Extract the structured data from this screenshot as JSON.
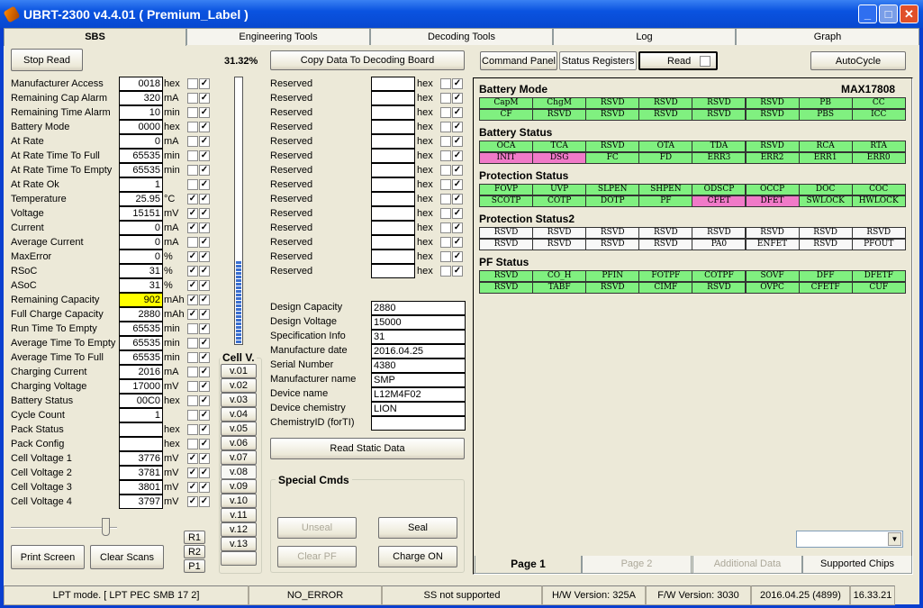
{
  "window": {
    "title": "UBRT-2300 v4.4.01  ( Premium_Label )",
    "minimize": "_",
    "maximize": "□",
    "close": "✕"
  },
  "tabs": [
    {
      "label": "SBS",
      "active": true
    },
    {
      "label": "Engineering Tools"
    },
    {
      "label": "Decoding Tools"
    },
    {
      "label": "Log"
    },
    {
      "label": "Graph"
    }
  ],
  "sbs": {
    "stop_read": "Stop Read",
    "progress_label": "31.32%",
    "progress": 31.32,
    "copy_data": "Copy Data To Decoding Board",
    "rows": [
      {
        "label": "Manufacturer Access",
        "value": "0018",
        "unit": "hex",
        "c1": false,
        "c2": true
      },
      {
        "label": "Remaining Cap Alarm",
        "value": "320",
        "unit": "mA",
        "c1": false,
        "c2": true
      },
      {
        "label": "Remaining Time Alarm",
        "value": "10",
        "unit": "min",
        "c1": false,
        "c2": true
      },
      {
        "label": "Battery Mode",
        "value": "0000",
        "unit": "hex",
        "c1": false,
        "c2": true
      },
      {
        "label": "At Rate",
        "value": "0",
        "unit": "mA",
        "c1": false,
        "c2": true
      },
      {
        "label": "At Rate Time To Full",
        "value": "65535",
        "unit": "min",
        "c1": false,
        "c2": true
      },
      {
        "label": "At Rate Time To Empty",
        "value": "65535",
        "unit": "min",
        "c1": false,
        "c2": true
      },
      {
        "label": "At Rate Ok",
        "value": "1",
        "unit": "",
        "c1": false,
        "c2": true
      },
      {
        "label": "Temperature",
        "value": "25.95",
        "unit": "°C",
        "c1": true,
        "c2": true
      },
      {
        "label": "Voltage",
        "value": "15151",
        "unit": "mV",
        "c1": true,
        "c2": true
      },
      {
        "label": "Current",
        "value": "0",
        "unit": "mA",
        "c1": true,
        "c2": true
      },
      {
        "label": "Average Current",
        "value": "0",
        "unit": "mA",
        "c1": false,
        "c2": true
      },
      {
        "label": "MaxError",
        "value": "0",
        "unit": "%",
        "c1": true,
        "c2": true
      },
      {
        "label": "RSoC",
        "value": "31",
        "unit": "%",
        "c1": true,
        "c2": true
      },
      {
        "label": "ASoC",
        "value": "31",
        "unit": "%",
        "c1": true,
        "c2": true
      },
      {
        "label": "Remaining Capacity",
        "value": "902",
        "unit": "mAh",
        "c1": true,
        "c2": true,
        "highlight": "#ffff00"
      },
      {
        "label": "Full Charge Capacity",
        "value": "2880",
        "unit": "mAh",
        "c1": true,
        "c2": true
      },
      {
        "label": "Run Time To Empty",
        "value": "65535",
        "unit": "min",
        "c1": false,
        "c2": true
      },
      {
        "label": "Average Time To Empty",
        "value": "65535",
        "unit": "min",
        "c1": false,
        "c2": true
      },
      {
        "label": "Average Time To Full",
        "value": "65535",
        "unit": "min",
        "c1": false,
        "c2": true
      },
      {
        "label": "Charging Current",
        "value": "2016",
        "unit": "mA",
        "c1": false,
        "c2": true
      },
      {
        "label": "Charging Voltage",
        "value": "17000",
        "unit": "mV",
        "c1": false,
        "c2": true
      },
      {
        "label": "Battery Status",
        "value": "00C0",
        "unit": "hex",
        "c1": false,
        "c2": true
      },
      {
        "label": "Cycle Count",
        "value": "1",
        "unit": "",
        "c1": false,
        "c2": true
      },
      {
        "label": "Pack Status",
        "value": "",
        "unit": "hex",
        "c1": false,
        "c2": true
      },
      {
        "label": "Pack Config",
        "value": "",
        "unit": "hex",
        "c1": false,
        "c2": true
      },
      {
        "label": "Cell Voltage 1",
        "value": "3776",
        "unit": "mV",
        "c1": true,
        "c2": true
      },
      {
        "label": "Cell Voltage 2",
        "value": "3781",
        "unit": "mV",
        "c1": true,
        "c2": true
      },
      {
        "label": "Cell Voltage 3",
        "value": "3801",
        "unit": "mV",
        "c1": true,
        "c2": true
      },
      {
        "label": "Cell Voltage 4",
        "value": "3797",
        "unit": "mV",
        "c1": true,
        "c2": true
      }
    ],
    "reserved": [
      {
        "label": "Reserved",
        "value": "",
        "unit": "hex",
        "c1": false,
        "c2": true
      },
      {
        "label": "Reserved",
        "value": "",
        "unit": "hex",
        "c1": false,
        "c2": true
      },
      {
        "label": "Reserved",
        "value": "",
        "unit": "hex",
        "c1": false,
        "c2": true
      },
      {
        "label": "Reserved",
        "value": "",
        "unit": "hex",
        "c1": false,
        "c2": true
      },
      {
        "label": "Reserved",
        "value": "",
        "unit": "hex",
        "c1": false,
        "c2": true
      },
      {
        "label": "Reserved",
        "value": "",
        "unit": "hex",
        "c1": false,
        "c2": true
      },
      {
        "label": "Reserved",
        "value": "",
        "unit": "hex",
        "c1": false,
        "c2": true
      },
      {
        "label": "Reserved",
        "value": "",
        "unit": "hex",
        "c1": false,
        "c2": true
      },
      {
        "label": "Reserved",
        "value": "",
        "unit": "hex",
        "c1": false,
        "c2": true
      },
      {
        "label": "Reserved",
        "value": "",
        "unit": "hex",
        "c1": false,
        "c2": true
      },
      {
        "label": "Reserved",
        "value": "",
        "unit": "hex",
        "c1": false,
        "c2": true
      },
      {
        "label": "Reserved",
        "value": "",
        "unit": "hex",
        "c1": false,
        "c2": true
      },
      {
        "label": "Reserved",
        "value": "",
        "unit": "hex",
        "c1": false,
        "c2": true
      },
      {
        "label": "Reserved",
        "value": "",
        "unit": "hex",
        "c1": false,
        "c2": true
      }
    ],
    "static": [
      {
        "label": "Design Capacity",
        "value": "2880"
      },
      {
        "label": "Design Voltage",
        "value": "15000"
      },
      {
        "label": "Specification Info",
        "value": "31"
      },
      {
        "label": "Manufacture date",
        "value": "2016.04.25"
      },
      {
        "label": "Serial Number",
        "value": "4380"
      },
      {
        "label": "Manufacturer name",
        "value": "SMP"
      },
      {
        "label": "Device name",
        "value": "L12M4F02"
      },
      {
        "label": "Device chemistry",
        "value": "LION"
      },
      {
        "label": "ChemistryID (forTI)",
        "value": ""
      }
    ],
    "read_static": "Read Static Data",
    "special_cmds": {
      "title": "Special Cmds",
      "unseal": "Unseal",
      "seal": "Seal",
      "clear_pf": "Clear PF",
      "charge_on": "Charge ON"
    },
    "cell_v": {
      "title": "Cell V.",
      "buttons": [
        "v.01",
        "v.02",
        "v.03",
        "v.04",
        "v.05",
        "v.06",
        "v.07",
        "v.08",
        "v.09",
        "v.10",
        "v.11",
        "v.12",
        "v.13",
        ""
      ],
      "pressed": "v.08"
    },
    "r_buttons": [
      "R1",
      "R2",
      "P1"
    ],
    "print_screen": "Print Screen",
    "clear_scans": "Clear Scans"
  },
  "right": {
    "command_panel": "Command Panel",
    "status_registers": "Status Registers",
    "read": "Read",
    "read_checked": false,
    "autocycle": "AutoCycle",
    "chip": "MAX17808",
    "colors": {
      "green": "#80f080",
      "pink": "#f07ac8",
      "white": "#f8f8f8"
    },
    "sections": [
      {
        "title": "Battery Mode",
        "rows": [
          [
            "CapM",
            "ChgM",
            "RSVD",
            "RSVD",
            "RSVD",
            "RSVD",
            "PB",
            "CC"
          ],
          [
            "CF",
            "RSVD",
            "RSVD",
            "RSVD",
            "RSVD",
            "RSVD",
            "PBS",
            "ICC"
          ]
        ],
        "pink": [],
        "color": "green"
      },
      {
        "title": "Battery Status",
        "rows": [
          [
            "OCA",
            "TCA",
            "RSVD",
            "OTA",
            "TDA",
            "RSVD",
            "RCA",
            "RTA"
          ],
          [
            "INIT",
            "DSG",
            "FC",
            "FD",
            "ERR3",
            "ERR2",
            "ERR1",
            "ERR0"
          ]
        ],
        "pink": [
          "INIT",
          "DSG"
        ],
        "color": "green"
      },
      {
        "title": "Protection Status",
        "rows": [
          [
            "FOVP",
            "UVP",
            "SLPEN",
            "SHPEN",
            "ODSCP",
            "OCCP",
            "DOC",
            "COC"
          ],
          [
            "SCOTP",
            "COTP",
            "DOTP",
            "PF",
            "CFET",
            "DFET",
            "SWLOCK",
            "HWLOCK"
          ]
        ],
        "pink": [
          "CFET",
          "DFET"
        ],
        "color": "green"
      },
      {
        "title": "Protection Status2",
        "rows": [
          [
            "RSVD",
            "RSVD",
            "RSVD",
            "RSVD",
            "RSVD",
            "RSVD",
            "RSVD",
            "RSVD"
          ],
          [
            "RSVD",
            "RSVD",
            "RSVD",
            "RSVD",
            "PA0",
            "ENFET",
            "RSVD",
            "PFOUT"
          ]
        ],
        "pink": [],
        "color": "white"
      },
      {
        "title": "PF Status",
        "rows": [
          [
            "RSVD",
            "CO_H",
            "PFIN",
            "FOTPF",
            "COTPF",
            "SOVF",
            "DFF",
            "DFETF"
          ],
          [
            "RSVD",
            "TABF",
            "RSVD",
            "CIMF",
            "RSVD",
            "OVPC",
            "CFETF",
            "CUF"
          ]
        ],
        "pink": [],
        "color": "green"
      }
    ],
    "dropdown": "",
    "page_tabs": [
      {
        "label": "Page 1",
        "active": true
      },
      {
        "label": "Page 2",
        "disabled": true
      },
      {
        "label": "Additional Data",
        "disabled": true
      },
      {
        "label": "Supported Chips"
      }
    ]
  },
  "statusbar": [
    "LPT mode. [ LPT  PEC  SMB  17 2]",
    "NO_ERROR",
    "SS not supported",
    "H/W Version: 325A",
    "F/W Version: 3030",
    "2016.04.25  (4899)",
    "16.33.21"
  ]
}
